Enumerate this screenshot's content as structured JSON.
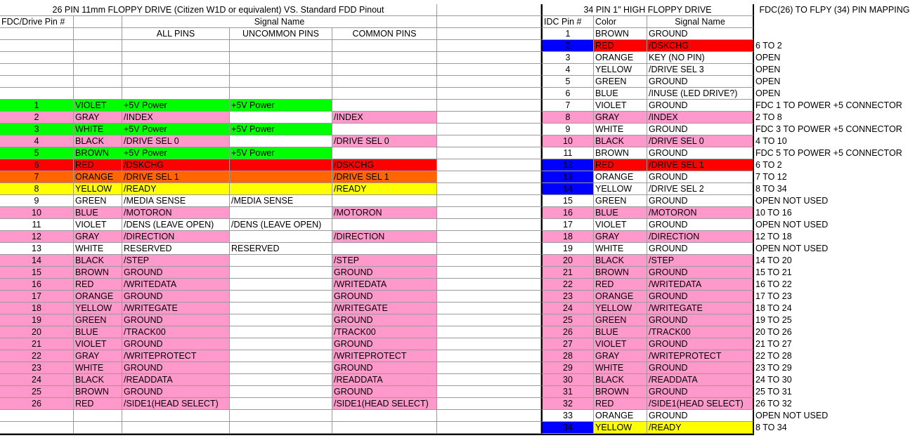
{
  "headers": {
    "left_title": "26 PIN 11mm FLOPPY DRIVE (Citizen W1D or equivalent) VS. Standard FDD Pinout",
    "right_title": "34 PIN 1\" HIGH FLOPPY DRIVE",
    "mapping_title": "FDC(26) TO FLPY (34) PIN MAPPING",
    "fdc_pin_label": "FDC/Drive  Pin #",
    "signal_name_label": "Signal Name",
    "all_pins_label": "ALL PINS",
    "uncommon_pins_label": "UNCOMMON PINS",
    "common_pins_label": "COMMON PINS",
    "idc_pin_label": "IDC Pin #",
    "color_label": "Color",
    "idc_signal_label": "Signal Name"
  },
  "colors": {
    "pink": "#ff99cc",
    "green": "#00ff00",
    "red": "#ff0000",
    "orange": "#ff6600",
    "yellow": "#ffff00",
    "blue": "#0000ff",
    "white": "#ffffff"
  },
  "rows": [
    {
      "pin": "",
      "color": "",
      "all": "",
      "uncommon": "",
      "common": "",
      "rowbg": "",
      "idc": "1",
      "idc_color": "BROWN",
      "idc_signal": "GROUND",
      "mapping": "",
      "idcbg": ""
    },
    {
      "pin": "",
      "color": "",
      "all": "",
      "uncommon": "",
      "common": "",
      "rowbg": "",
      "idc": "2",
      "idc_color": "RED",
      "idc_signal": "/DSKCHG",
      "mapping": "6 TO 2",
      "idcbg": "red",
      "pinbg": "blue"
    },
    {
      "pin": "",
      "color": "",
      "all": "",
      "uncommon": "",
      "common": "",
      "rowbg": "",
      "idc": "3",
      "idc_color": "ORANGE",
      "idc_signal": "KEY (NO PIN)",
      "mapping": "OPEN",
      "idcbg": ""
    },
    {
      "pin": "",
      "color": "",
      "all": "",
      "uncommon": "",
      "common": "",
      "rowbg": "",
      "idc": "4",
      "idc_color": "YELLOW",
      "idc_signal": "/DRIVE SEL 3",
      "mapping": "OPEN",
      "idcbg": ""
    },
    {
      "pin": "",
      "color": "",
      "all": "",
      "uncommon": "",
      "common": "",
      "rowbg": "",
      "idc": "5",
      "idc_color": "GREEN",
      "idc_signal": "GROUND",
      "mapping": "OPEN",
      "idcbg": ""
    },
    {
      "pin": "",
      "color": "",
      "all": "",
      "uncommon": "",
      "common": "",
      "rowbg": "",
      "idc": "6",
      "idc_color": "BLUE",
      "idc_signal": "/INUSE (LED DRIVE?)",
      "mapping": "OPEN",
      "idcbg": ""
    },
    {
      "pin": "1",
      "color": "VIOLET",
      "all": "+5V Power",
      "uncommon": "+5V Power",
      "common": "",
      "rowbg": "green",
      "idc": "7",
      "idc_color": "VIOLET",
      "idc_signal": "GROUND",
      "mapping": "FDC 1 TO POWER +5 CONNECTOR",
      "idcbg": ""
    },
    {
      "pin": "2",
      "color": "GRAY",
      "all": "/INDEX",
      "uncommon": "",
      "common": "/INDEX",
      "rowbg": "pink",
      "idc": "8",
      "idc_color": "GRAY",
      "idc_signal": "/INDEX",
      "mapping": "2 TO 8",
      "idcbg": "pink"
    },
    {
      "pin": "3",
      "color": "WHITE",
      "all": "+5V Power",
      "uncommon": "+5V Power",
      "common": "",
      "rowbg": "green",
      "idc": "9",
      "idc_color": "WHITE",
      "idc_signal": "GROUND",
      "mapping": "FDC 3 TO POWER +5 CONNECTOR",
      "idcbg": ""
    },
    {
      "pin": "4",
      "color": "BLACK",
      "all": "/DRIVE SEL 0",
      "uncommon": "",
      "common": "/DRIVE SEL 0",
      "rowbg": "pink",
      "idc": "10",
      "idc_color": "BLACK",
      "idc_signal": "/DRIVE SEL 0",
      "mapping": "4 TO 10",
      "idcbg": "pink"
    },
    {
      "pin": "5",
      "color": "BROWN",
      "all": "+5V Power",
      "uncommon": "+5V Power",
      "common": "",
      "rowbg": "green",
      "idc": "11",
      "idc_color": "BROWN",
      "idc_signal": "GROUND",
      "mapping": "FDC 5 TO POWER +5 CONNECTOR",
      "idcbg": ""
    },
    {
      "pin": "6",
      "color": "RED",
      "all": "/DSKCHG",
      "uncommon": "",
      "common": "/DSKCHG",
      "rowbg": "red",
      "idc": "12",
      "idc_color": "RED",
      "idc_signal": "/DRIVE SEL 1",
      "mapping": "6 TO 2",
      "idcbg": "red",
      "pinbg": "blue"
    },
    {
      "pin": "7",
      "color": "ORANGE",
      "all": "/DRIVE SEL 1",
      "uncommon": "",
      "common": "/DRIVE SEL 1",
      "rowbg": "orange",
      "idc": "13",
      "idc_color": "ORANGE",
      "idc_signal": "GROUND",
      "mapping": "7 TO 12",
      "idcbg": "",
      "pinbg": "blue"
    },
    {
      "pin": "8",
      "color": "YELLOW",
      "all": "/READY",
      "uncommon": "",
      "common": "/READY",
      "rowbg": "yellow",
      "idc": "14",
      "idc_color": "YELLOW",
      "idc_signal": "/DRIVE SEL 2",
      "mapping": "8 TO 34",
      "idcbg": "",
      "pinbg": "blue"
    },
    {
      "pin": "9",
      "color": "GREEN",
      "all": "/MEDIA SENSE",
      "uncommon": "/MEDIA SENSE",
      "common": "",
      "rowbg": "",
      "idc": "15",
      "idc_color": "GREEN",
      "idc_signal": "GROUND",
      "mapping": "OPEN NOT USED",
      "idcbg": ""
    },
    {
      "pin": "10",
      "color": "BLUE",
      "all": "/MOTORON",
      "uncommon": "",
      "common": "/MOTORON",
      "rowbg": "pink",
      "idc": "16",
      "idc_color": "BLUE",
      "idc_signal": "/MOTORON",
      "mapping": "10 TO 16",
      "idcbg": "pink"
    },
    {
      "pin": "11",
      "color": "VIOLET",
      "all": "/DENS (LEAVE OPEN)",
      "uncommon": "/DENS (LEAVE OPEN)",
      "common": "",
      "rowbg": "",
      "idc": "17",
      "idc_color": "VIOLET",
      "idc_signal": "GROUND",
      "mapping": "OPEN NOT USED",
      "idcbg": ""
    },
    {
      "pin": "12",
      "color": "GRAY",
      "all": "/DIRECTION",
      "uncommon": "",
      "common": "/DIRECTION",
      "rowbg": "pink",
      "idc": "18",
      "idc_color": "GRAY",
      "idc_signal": "/DIRECTION",
      "mapping": "12 TO 18",
      "idcbg": "pink"
    },
    {
      "pin": "13",
      "color": "WHITE",
      "all": "RESERVED",
      "uncommon": "RESERVED",
      "common": "",
      "rowbg": "",
      "idc": "19",
      "idc_color": "WHITE",
      "idc_signal": "GROUND",
      "mapping": "OPEN NOT USED",
      "idcbg": ""
    },
    {
      "pin": "14",
      "color": "BLACK",
      "all": "/STEP",
      "uncommon": "",
      "common": "/STEP",
      "rowbg": "pink",
      "idc": "20",
      "idc_color": "BLACK",
      "idc_signal": "/STEP",
      "mapping": "14 TO 20",
      "idcbg": "pink"
    },
    {
      "pin": "15",
      "color": "BROWN",
      "all": "GROUND",
      "uncommon": "",
      "common": "GROUND",
      "rowbg": "pink",
      "idc": "21",
      "idc_color": "BROWN",
      "idc_signal": "GROUND",
      "mapping": "15 TO 21",
      "idcbg": "pink"
    },
    {
      "pin": "16",
      "color": "RED",
      "all": "/WRITEDATA",
      "uncommon": "",
      "common": "/WRITEDATA",
      "rowbg": "pink",
      "idc": "22",
      "idc_color": "RED",
      "idc_signal": "/WRITEDATA",
      "mapping": "16 TO 22",
      "idcbg": "pink"
    },
    {
      "pin": "17",
      "color": "ORANGE",
      "all": "GROUND",
      "uncommon": "",
      "common": "GROUND",
      "rowbg": "pink",
      "idc": "23",
      "idc_color": "ORANGE",
      "idc_signal": "GROUND",
      "mapping": "17 TO 23",
      "idcbg": "pink"
    },
    {
      "pin": "18",
      "color": "YELLOW",
      "all": "/WRITEGATE",
      "uncommon": "",
      "common": "/WRITEGATE",
      "rowbg": "pink",
      "idc": "24",
      "idc_color": "YELLOW",
      "idc_signal": "/WRITEGATE",
      "mapping": "18 TO 24",
      "idcbg": "pink"
    },
    {
      "pin": "19",
      "color": "GREEN",
      "all": "GROUND",
      "uncommon": "",
      "common": "GROUND",
      "rowbg": "pink",
      "idc": "25",
      "idc_color": "GREEN",
      "idc_signal": "GROUND",
      "mapping": "19 TO 25",
      "idcbg": "pink"
    },
    {
      "pin": "20",
      "color": "BLUE",
      "all": "/TRACK00",
      "uncommon": "",
      "common": "/TRACK00",
      "rowbg": "pink",
      "idc": "26",
      "idc_color": "BLUE",
      "idc_signal": "/TRACK00",
      "mapping": "20 TO 26",
      "idcbg": "pink"
    },
    {
      "pin": "21",
      "color": "VIOLET",
      "all": "GROUND",
      "uncommon": "",
      "common": "GROUND",
      "rowbg": "pink",
      "idc": "27",
      "idc_color": "VIOLET",
      "idc_signal": "GROUND",
      "mapping": "21 TO 27",
      "idcbg": "pink"
    },
    {
      "pin": "22",
      "color": "GRAY",
      "all": "/WRITEPROTECT",
      "uncommon": "",
      "common": "/WRITEPROTECT",
      "rowbg": "pink",
      "idc": "28",
      "idc_color": "GRAY",
      "idc_signal": "/WRITEPROTECT",
      "mapping": "22 TO 28",
      "idcbg": "pink"
    },
    {
      "pin": "23",
      "color": "WHITE",
      "all": "GROUND",
      "uncommon": "",
      "common": "GROUND",
      "rowbg": "pink",
      "idc": "29",
      "idc_color": "WHITE",
      "idc_signal": "GROUND",
      "mapping": "23 TO 29",
      "idcbg": "pink"
    },
    {
      "pin": "24",
      "color": "BLACK",
      "all": "/READDATA",
      "uncommon": "",
      "common": "/READDATA",
      "rowbg": "pink",
      "idc": "30",
      "idc_color": "BLACK",
      "idc_signal": "/READDATA",
      "mapping": "24 TO 30",
      "idcbg": "pink"
    },
    {
      "pin": "25",
      "color": "BROWN",
      "all": "GROUND",
      "uncommon": "",
      "common": "GROUND",
      "rowbg": "pink",
      "idc": "31",
      "idc_color": "BROWN",
      "idc_signal": "GROUND",
      "mapping": "25 TO 31",
      "idcbg": "pink"
    },
    {
      "pin": "26",
      "color": "RED",
      "all": "/SIDE1(HEAD SELECT)",
      "uncommon": "",
      "common": "/SIDE1(HEAD SELECT)",
      "rowbg": "pink",
      "idc": "32",
      "idc_color": "RED",
      "idc_signal": "/SIDE1(HEAD SELECT)",
      "mapping": "26 TO 32",
      "idcbg": "pink"
    },
    {
      "pin": "",
      "color": "",
      "all": "",
      "uncommon": "",
      "common": "",
      "rowbg": "",
      "idc": "33",
      "idc_color": "ORANGE",
      "idc_signal": "GROUND",
      "mapping": "OPEN NOT USED",
      "idcbg": ""
    },
    {
      "pin": "",
      "color": "",
      "all": "",
      "uncommon": "",
      "common": "",
      "rowbg": "",
      "idc": "34",
      "idc_color": "YELLOW",
      "idc_signal": "/READY",
      "mapping": "8 TO 34",
      "idcbg": "yellow",
      "pinbg": "blue"
    }
  ]
}
